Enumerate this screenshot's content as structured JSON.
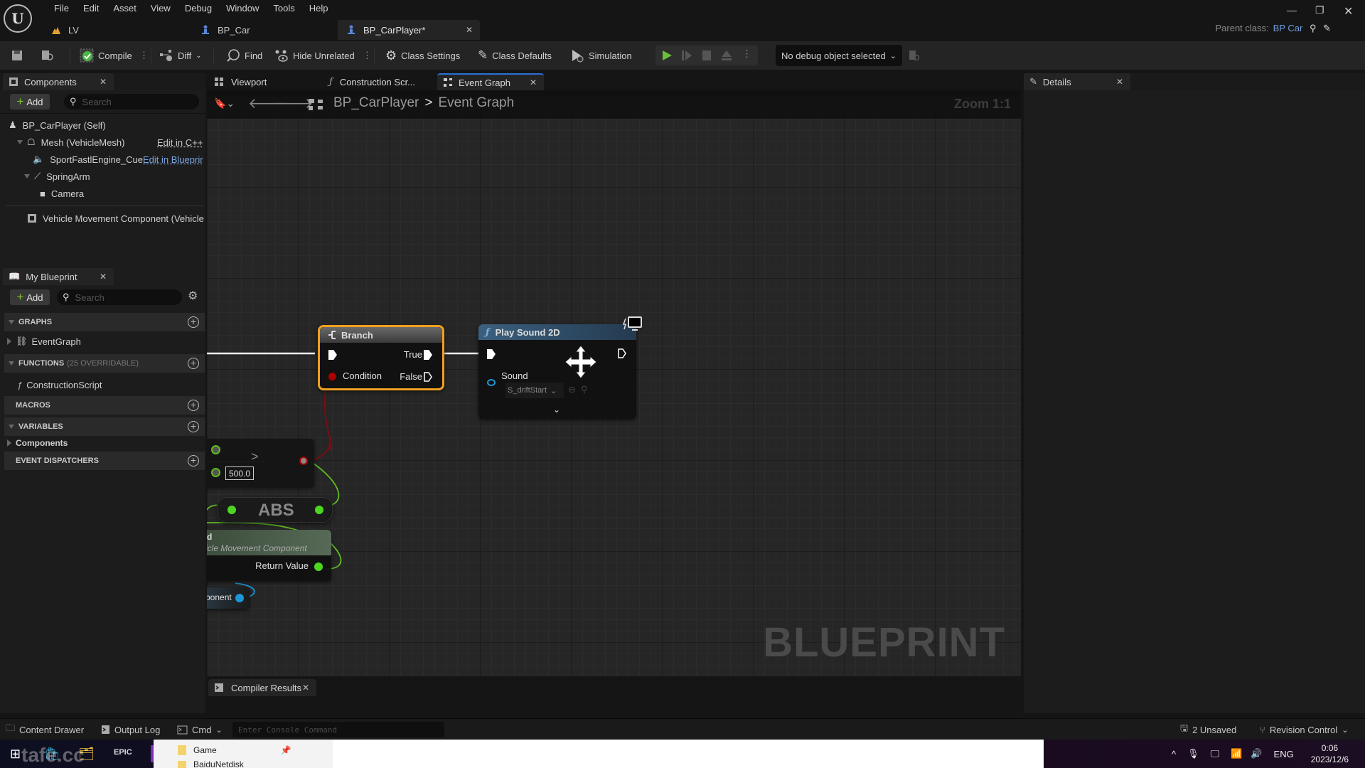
{
  "menu": [
    "File",
    "Edit",
    "Asset",
    "View",
    "Debug",
    "Window",
    "Tools",
    "Help"
  ],
  "doc_tabs": [
    {
      "label": "LV",
      "icon": "level-icon",
      "active": false
    },
    {
      "label": "BP_Car",
      "icon": "blueprint-actor-icon",
      "active": false
    },
    {
      "label": "BP_CarPlayer*",
      "icon": "blueprint-actor-icon",
      "active": true
    }
  ],
  "parent_class": {
    "label": "Parent class:",
    "value": "BP Car"
  },
  "toolbar": {
    "compile": "Compile",
    "diff": "Diff",
    "find": "Find",
    "hide_unrelated": "Hide Unrelated",
    "class_settings": "Class Settings",
    "class_defaults": "Class Defaults",
    "simulation": "Simulation",
    "debug_object": "No debug object selected"
  },
  "components_panel": {
    "title": "Components",
    "add": "Add",
    "search_placeholder": "Search",
    "items": [
      {
        "label": "BP_CarPlayer (Self)",
        "icon": "pawn-icon"
      },
      {
        "label": "Mesh (VehicleMesh)",
        "icon": "skeletal-mesh-icon",
        "action": "Edit in C++"
      },
      {
        "label": "SportFastlEngine_Cue",
        "icon": "audio-icon",
        "action": "Edit in Blueprir"
      },
      {
        "label": "SpringArm",
        "icon": "spring-arm-icon"
      },
      {
        "label": "Camera",
        "icon": "camera-icon"
      },
      {
        "label": "Vehicle Movement Component (Vehiclel",
        "icon": "component-icon"
      }
    ]
  },
  "my_blueprint": {
    "title": "My Blueprint",
    "add": "Add",
    "search_placeholder": "Search",
    "sections": {
      "graphs": "GRAPHS",
      "event_graph": "EventGraph",
      "functions": "FUNCTIONS",
      "functions_note": "(25 OVERRIDABLE)",
      "construction_script": "ConstructionScript",
      "macros": "MACROS",
      "variables": "VARIABLES",
      "components": "Components",
      "event_dispatchers": "EVENT DISPATCHERS"
    }
  },
  "graph_tabs": [
    {
      "label": "Viewport",
      "icon": "viewport-icon"
    },
    {
      "label": "Construction Scr...",
      "icon": "function-icon"
    },
    {
      "label": "Event Graph",
      "icon": "event-graph-icon",
      "active": true
    }
  ],
  "breadcrumb": {
    "root": "BP_CarPlayer",
    "sep": ">",
    "current": "Event Graph"
  },
  "zoom_label": "Zoom 1:1",
  "watermark": "BLUEPRINT",
  "nodes": {
    "branch": {
      "title": "Branch",
      "true_label": "True",
      "false_label": "False",
      "condition_label": "Condition"
    },
    "play_sound": {
      "title": "Play Sound 2D",
      "sound_label": "Sound",
      "sound_value": "S_driftStart"
    },
    "compare": {
      "operator": ">",
      "value": "500.0"
    },
    "abs": {
      "title": "ABS"
    },
    "get_vmc": {
      "title_partial": "d",
      "subtitle": "icle Movement Component",
      "return_label": "Return Value"
    },
    "component_ref": {
      "label": "ponent"
    }
  },
  "details_panel": {
    "title": "Details"
  },
  "compiler_results": "Compiler Results",
  "statusbar": {
    "content_drawer": "Content Drawer",
    "output_log": "Output Log",
    "cmd": "Cmd",
    "console_placeholder": "Enter Console Command",
    "unsaved": "2 Unsaved",
    "revision_control": "Revision Control"
  },
  "taskbar": {
    "explorer_items": [
      "Game",
      "BaiduNetdisk"
    ],
    "lang": "ENG",
    "time": "0:06",
    "date": "2023/12/6",
    "watermark": "tafe.cc"
  }
}
